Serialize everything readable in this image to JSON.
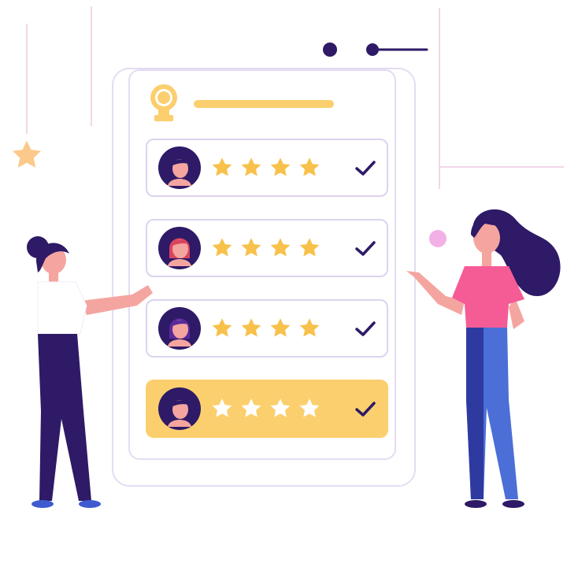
{
  "colors": {
    "accent": "#fbcf6e",
    "star": "#f7c14b",
    "star_on_highlight": "#ffffff",
    "navy": "#2e1a66",
    "pink": "#f55c96",
    "blue": "#4b6fd6",
    "border": "#ddd3f0"
  },
  "header": {
    "icon": "award-badge-icon"
  },
  "reviews": [
    {
      "avatar": "avatar-woman-dark-hair-icon",
      "rating": 4,
      "checked": true,
      "highlighted": false
    },
    {
      "avatar": "avatar-woman-red-hair-icon",
      "rating": 4,
      "checked": true,
      "highlighted": false
    },
    {
      "avatar": "avatar-woman-purple-hair-icon",
      "rating": 4,
      "checked": true,
      "highlighted": false
    },
    {
      "avatar": "avatar-woman-dark-hair-icon",
      "rating": 4,
      "checked": true,
      "highlighted": true
    }
  ],
  "decorations": [
    "star-icon",
    "dot-icon",
    "slider-icon"
  ]
}
